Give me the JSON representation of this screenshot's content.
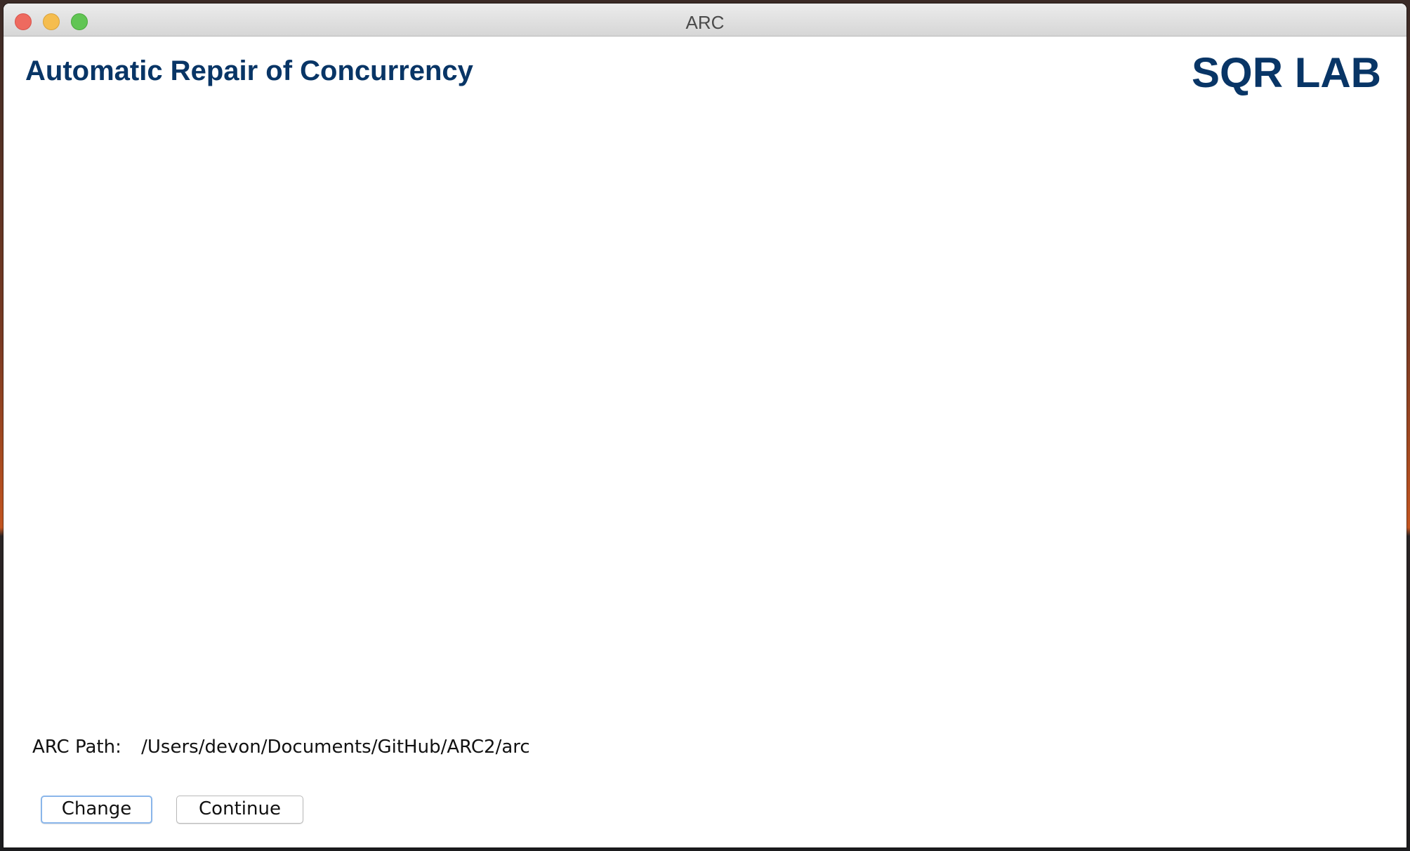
{
  "window": {
    "title": "ARC"
  },
  "header": {
    "app_title": "Automatic Repair of Concurrency",
    "logo_text": "SQR LAB"
  },
  "path": {
    "label": "ARC Path:",
    "value": "/Users/devon/Documents/GitHub/ARC2/arc"
  },
  "buttons": {
    "change_label": "Change",
    "continue_label": "Continue"
  },
  "colors": {
    "brand": "#083566",
    "focus_ring": "#8ab6ea",
    "close": "#ee6a5f",
    "minimize": "#f5bd4f",
    "maximize": "#61c554"
  },
  "icons": {
    "close": "close-window-icon",
    "minimize": "minimize-window-icon",
    "maximize": "zoom-window-icon"
  }
}
